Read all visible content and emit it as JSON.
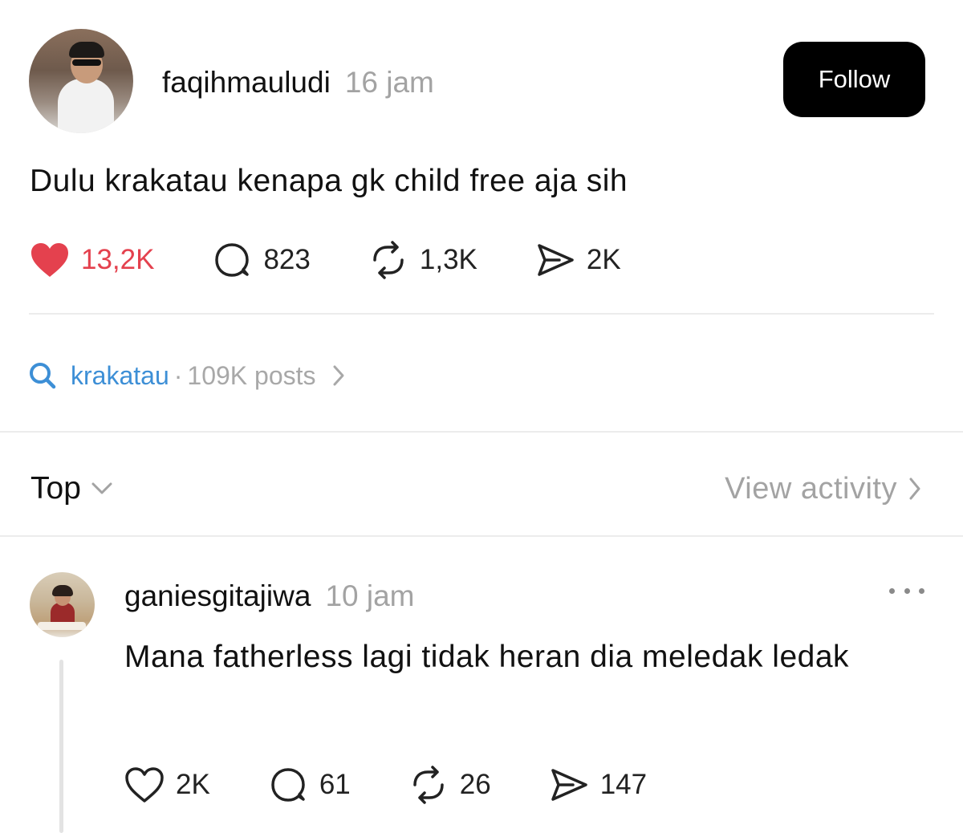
{
  "post": {
    "username": "faqihmauludi",
    "time": "16 jam",
    "follow_label": "Follow",
    "text": "Dulu krakatau kenapa gk child free aja sih",
    "stats": {
      "likes": "13,2K",
      "comments": "823",
      "reposts": "1,3K",
      "shares": "2K"
    },
    "liked": true
  },
  "topic": {
    "tag": "krakatau",
    "separator": "·",
    "posts": "109K posts"
  },
  "sort": {
    "label": "Top",
    "view_activity": "View activity"
  },
  "reply": {
    "username": "ganiesgitajiwa",
    "time": "10 jam",
    "text": "Mana fatherless lagi tidak heran dia meledak ledak",
    "stats": {
      "likes": "2K",
      "comments": "61",
      "reposts": "26",
      "shares": "147"
    }
  },
  "colors": {
    "like_red": "#e4414e",
    "link_blue": "#3d8fd6",
    "muted_gray": "#a3a3a3"
  },
  "icons": [
    "heart-icon",
    "comment-icon",
    "repost-icon",
    "share-icon",
    "search-icon",
    "chevron-right-icon",
    "chevron-down-icon",
    "more-icon"
  ]
}
